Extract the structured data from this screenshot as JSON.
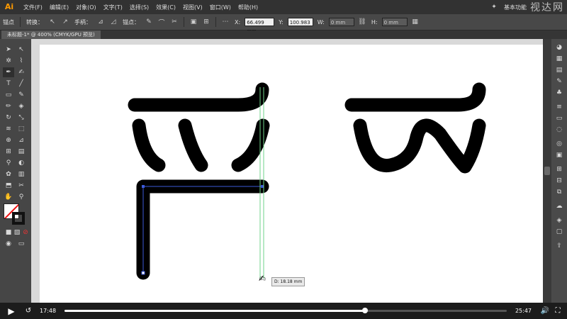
{
  "app": {
    "logo": "Ai",
    "menu": [
      "文件(F)",
      "编辑(E)",
      "对象(O)",
      "文字(T)",
      "选择(S)",
      "效果(C)",
      "视图(V)",
      "窗口(W)",
      "帮助(H)"
    ],
    "workspace": "基本功能",
    "watermark": "视达网"
  },
  "options_bar": {
    "selection_label": "锚点",
    "convert_label": "转换：",
    "handles_label": "手柄：",
    "anchor_label": "锚点：",
    "x_value": "66.499 mm",
    "y_value": "100.983",
    "w_value": "0 mm",
    "h_value": "0 mm"
  },
  "document": {
    "tab_title": "未标题-1* @ 400% (CMYK/GPU 预览)"
  },
  "canvas": {
    "distance_readout": "D: 18.18 mm"
  },
  "player": {
    "current_time": "17:48",
    "total_time": "25:47",
    "progress": 0.68
  },
  "icons": {
    "play": "play-icon",
    "replay": "replay-10-icon",
    "volume": "volume-icon",
    "fullscreen": "fullscreen-icon"
  },
  "colors": {
    "accent": "#ff9a00",
    "guide": "#6fd38a",
    "path_selection": "#3d5ad8"
  }
}
